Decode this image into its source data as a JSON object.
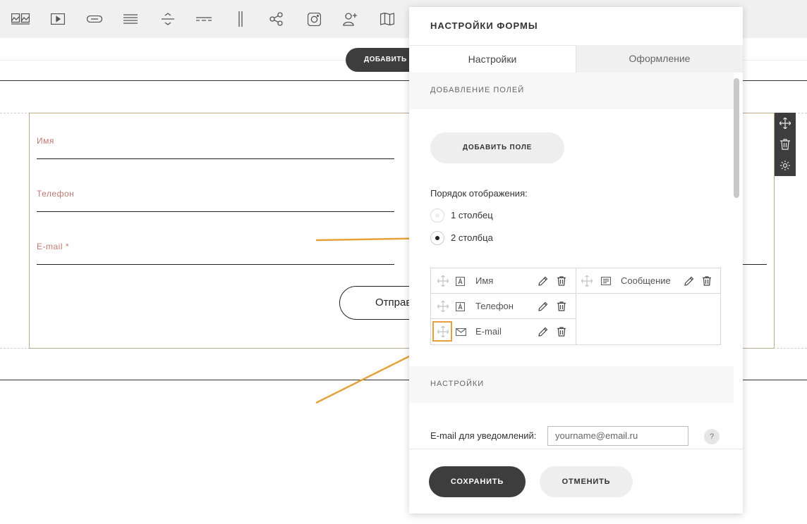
{
  "toolbar": {
    "icons": [
      "gallery-icon",
      "video-icon",
      "button-icon",
      "text-block-icon",
      "divider-icon",
      "line-icon",
      "columns-icon",
      "share-icon",
      "instagram-icon",
      "add-user-icon",
      "map-icon"
    ]
  },
  "page": {
    "add_section_label": "ДОБАВИТЬ С",
    "form": {
      "fields": [
        {
          "label": "Имя"
        },
        {
          "label": "Телефон"
        },
        {
          "label": "E-mail *"
        }
      ],
      "submit_label": "Отправ"
    }
  },
  "panel": {
    "title": "НАСТРОЙКИ ФОРМЫ",
    "tabs": [
      {
        "label": "Настройки",
        "active": true
      },
      {
        "label": "Оформление",
        "active": false
      }
    ],
    "fields_section": {
      "heading": "ДОБАВЛЕНИЕ ПОЛЕЙ",
      "add_field_label": "ДОБАВИТЬ ПОЛЕ",
      "order_label": "Порядок отображения:",
      "order_options": [
        {
          "label": "1 столбец",
          "checked": false
        },
        {
          "label": "2 столбца",
          "checked": true
        }
      ],
      "columns": [
        [
          {
            "type_icon": "text-field-icon",
            "name": "Имя"
          },
          {
            "type_icon": "text-field-icon",
            "name": "Телефон"
          },
          {
            "type_icon": "envelope-icon",
            "name": "E-mail"
          }
        ],
        [
          {
            "type_icon": "textarea-icon",
            "name": "Сообщение"
          }
        ]
      ]
    },
    "settings_section": {
      "heading": "НАСТРОЙКИ",
      "notify_label": "E-mail для уведомлений:",
      "notify_placeholder": "yourname@email.ru",
      "help_label": "?"
    },
    "footer": {
      "save_label": "СОХРАНИТЬ",
      "cancel_label": "ОТМЕНИТЬ"
    }
  },
  "colors": {
    "accent_orange": "#e8a13a",
    "label_red": "#c07a70",
    "dark_button": "#3d3d3d",
    "form_border": "#b9ab8c"
  }
}
